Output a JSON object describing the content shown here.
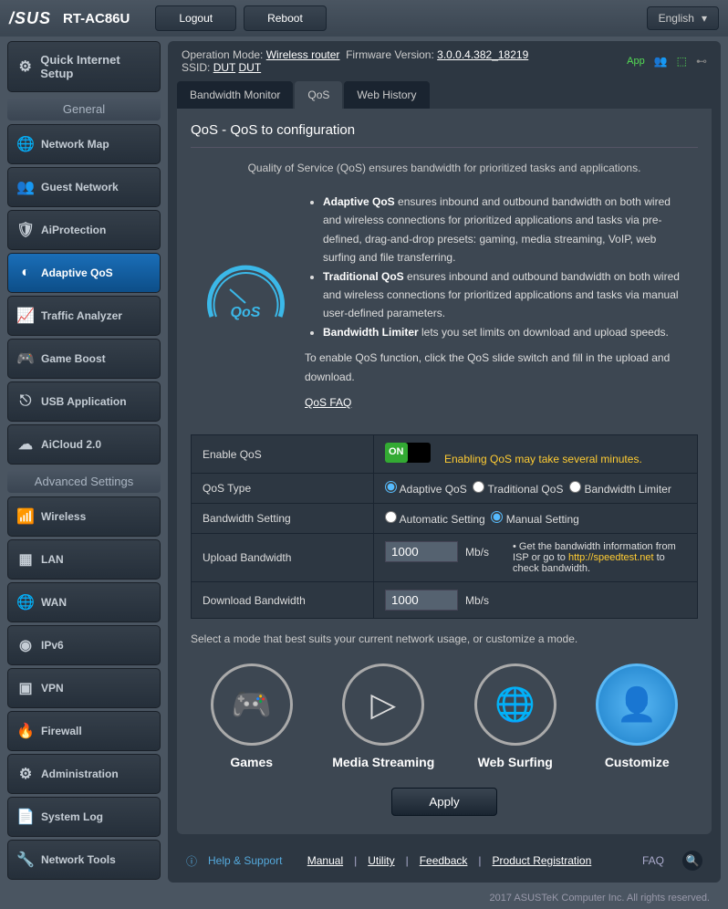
{
  "model": "RT-AC86U",
  "topbar": {
    "logout": "Logout",
    "reboot": "Reboot",
    "language": "English"
  },
  "info": {
    "opmode_lbl": "Operation Mode:",
    "opmode": "Wireless router",
    "fw_lbl": "Firmware Version:",
    "fw": "3.0.0.4.382_18219",
    "ssid_lbl": "SSID:",
    "ssid1": "DUT",
    "ssid2": "DUT",
    "app": "App"
  },
  "sidebar": {
    "quick": "Quick Internet Setup",
    "hdr1": "General",
    "items1": [
      "Network Map",
      "Guest Network",
      "AiProtection",
      "Adaptive QoS",
      "Traffic Analyzer",
      "Game Boost",
      "USB Application",
      "AiCloud 2.0"
    ],
    "hdr2": "Advanced Settings",
    "items2": [
      "Wireless",
      "LAN",
      "WAN",
      "IPv6",
      "VPN",
      "Firewall",
      "Administration",
      "System Log",
      "Network Tools"
    ]
  },
  "tabs": [
    "Bandwidth Monitor",
    "QoS",
    "Web History"
  ],
  "panel": {
    "title": "QoS - QoS to configuration",
    "intro": "Quality of Service (QoS) ensures bandwidth for prioritized tasks and applications.",
    "b1": "Adaptive QoS",
    "t1": " ensures inbound and outbound bandwidth on both wired and wireless connections for prioritized applications and tasks via pre-defined, drag-and-drop presets: gaming, media streaming, VoIP, web surfing and file transferring.",
    "b2": "Traditional QoS",
    "t2": " ensures inbound and outbound bandwidth on both wired and wireless connections for prioritized applications and tasks via manual user-defined parameters.",
    "b3": "Bandwidth Limiter",
    "t3": " lets you set limits on download and upload speeds.",
    "enable_txt": "To enable QoS function, click the QoS slide switch and fill in the upload and download.",
    "faq": "QoS FAQ"
  },
  "form": {
    "enable_lbl": "Enable QoS",
    "on": "ON",
    "warn": "Enabling QoS may take several minutes.",
    "type_lbl": "QoS Type",
    "type1": "Adaptive QoS",
    "type2": "Traditional QoS",
    "type3": "Bandwidth Limiter",
    "bw_lbl": "Bandwidth Setting",
    "bw1": "Automatic Setting",
    "bw2": "Manual Setting",
    "up_lbl": "Upload Bandwidth",
    "up_val": "1000",
    "unit": "Mb/s",
    "dn_lbl": "Download Bandwidth",
    "dn_val": "1000",
    "hint1": "Get the bandwidth information from ISP or go to ",
    "hint_link": "http://speedtest.net",
    "hint2": " to check bandwidth."
  },
  "modes": {
    "intro": "Select a mode that best suits your current network usage, or customize a mode.",
    "m1": "Games",
    "m2": "Media Streaming",
    "m3": "Web Surfing",
    "m4": "Customize"
  },
  "apply": "Apply",
  "footer": {
    "help": "Help & Support",
    "manual": "Manual",
    "utility": "Utility",
    "feedback": "Feedback",
    "reg": "Product Registration",
    "faq": "FAQ"
  },
  "copy": "2017 ASUSTeK Computer Inc. All rights reserved."
}
